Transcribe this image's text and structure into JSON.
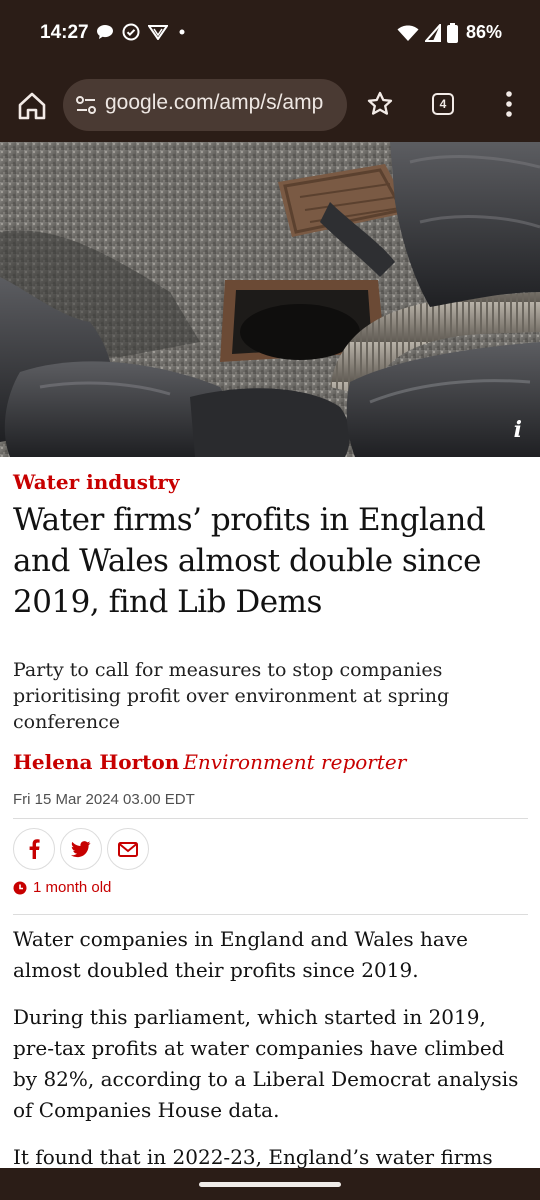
{
  "status_bar": {
    "time": "14:27",
    "battery": "86%",
    "icons_left": [
      "chat-bubble-icon",
      "check-circle-icon",
      "sensor-icon",
      "dot-icon"
    ],
    "icons_right": [
      "wifi-icon",
      "signal-icon",
      "battery-icon"
    ]
  },
  "browser": {
    "url": "google.com/amp/s/amp",
    "tab_count": "4"
  },
  "hero": {
    "info_label": "i"
  },
  "article": {
    "kicker": "Water industry",
    "headline": "Water firms’ profits in England and Wales almost double since 2019, find Lib Dems",
    "standfirst": "Party to call for measures to stop companies prioritising profit over environment at spring conference",
    "author": "Helena Horton",
    "author_role": "Environment reporter",
    "date": "Fri 15 Mar 2024 03.00 EDT",
    "age": "1 month old",
    "paragraphs": [
      "Water companies in England and Wales have almost doubled their profits since 2019.",
      "During this parliament, which started in 2019, pre-tax profits at water companies have climbed by 82%, according to a Liberal Democrat analysis of Companies House data.",
      "It found that in 2022-23, England’s water firms"
    ]
  },
  "colors": {
    "accent": "#c70000",
    "chrome": "#2b1d17",
    "url_pill": "#4a3a33"
  }
}
